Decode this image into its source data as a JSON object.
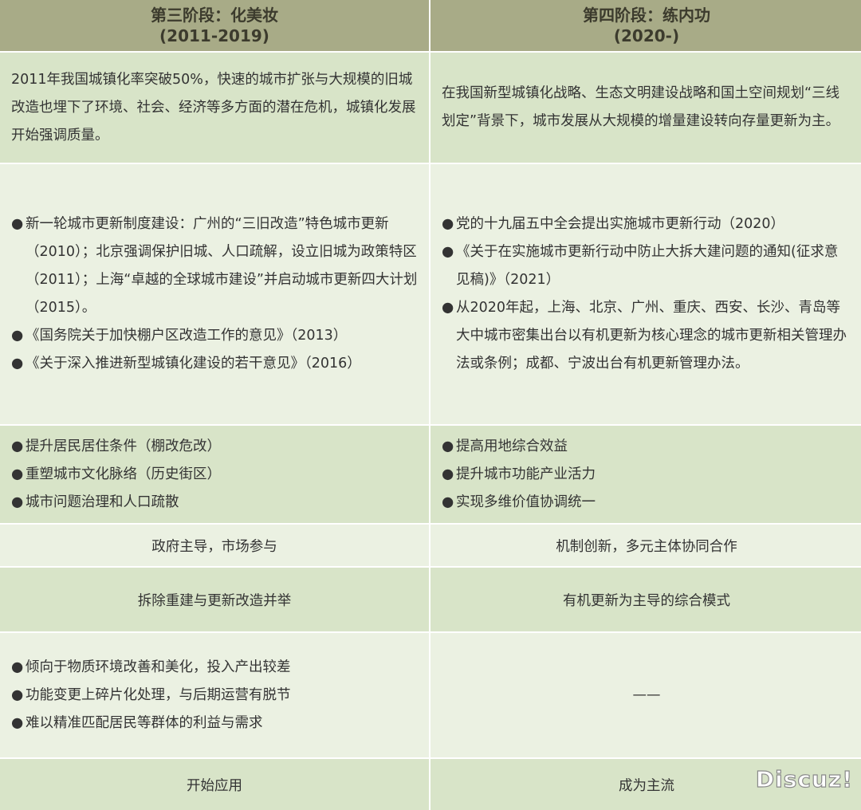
{
  "header": {
    "col1": {
      "line1": "第三阶段：化美妆",
      "line2": "(2011-2019)"
    },
    "col2": {
      "line1": "第四阶段：练内功",
      "line2": "(2020-)"
    }
  },
  "background": {
    "col1": "2011年我国城镇化率突破50%，快速的城市扩张与大规模的旧城改造也埋下了环境、社会、经济等多方面的潜在危机，城镇化发展开始强调质量。",
    "col2": "在我国新型城镇化战略、生态文明建设战略和国土空间规划“三线划定”背景下，城市发展从大规模的增量建设转向存量更新为主。"
  },
  "policies": {
    "col1": [
      "新一轮城市更新制度建设：广州的“三旧改造”特色城市更新（2010）；北京强调保护旧城、人口疏解，设立旧城为政策特区（2011）；上海“卓越的全球城市建设”并启动城市更新四大计划（2015）。",
      "《国务院关于加快棚户区改造工作的意见》（2013）",
      "《关于深入推进新型城镇化建设的若干意见》（2016）"
    ],
    "col2": [
      "党的十九届五中全会提出实施城市更新行动（2020）",
      "《关于在实施城市更新行动中防止大拆大建问题的通知(征求意见稿)》（2021）",
      "从2020年起，上海、北京、广州、重庆、西安、长沙、青岛等大中城市密集出台以有机更新为核心理念的城市更新相关管理办法或条例；成都、宁波出台有机更新管理办法。"
    ]
  },
  "goals": {
    "col1": [
      "提升居民居住条件（棚改危改）",
      "重塑城市文化脉络（历史街区）",
      "城市问题治理和人口疏散"
    ],
    "col2": [
      "提高用地综合效益",
      "提升城市功能产业活力",
      "实现多维价值协调统一"
    ]
  },
  "mechanism": {
    "col1": "政府主导，市场参与",
    "col2": "机制创新，多元主体协同合作"
  },
  "mode": {
    "col1": "拆除重建与更新改造并举",
    "col2": "有机更新为主导的综合模式"
  },
  "problems": {
    "col1": [
      "倾向于物质环境改善和美化，投入产出较差",
      "功能变更上碎片化处理，与后期运营有脱节",
      "难以精准匹配居民等群体的利益与需求"
    ],
    "col2": "——"
  },
  "status": {
    "col1": "开始应用",
    "col2": "成为主流"
  },
  "bullet_char": "●",
  "watermark": "Discuz!",
  "colors": {
    "header": "#a8ab87",
    "row_dark": "#d8e4c8",
    "row_light": "#ebf1e2",
    "text": "#333333"
  }
}
